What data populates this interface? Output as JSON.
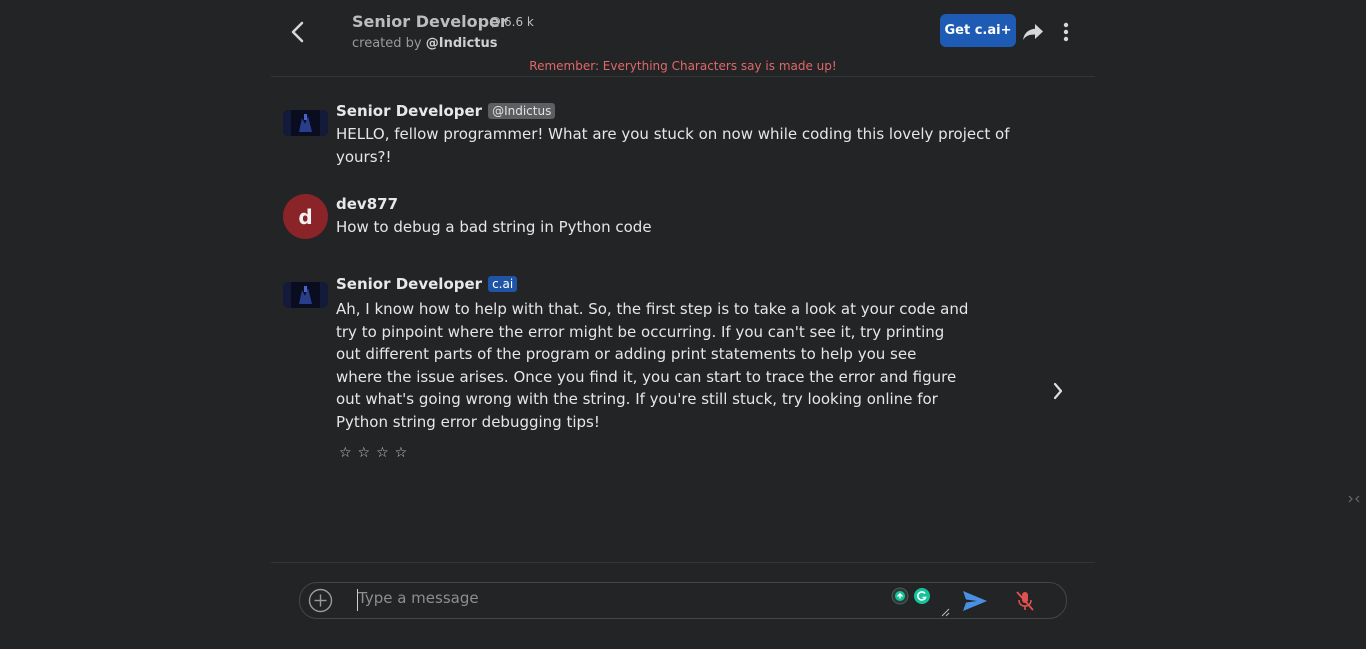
{
  "header": {
    "character_name": "Senior Developer",
    "chat_count": "6.6 k",
    "created_by_prefix": "created by",
    "creator_handle": "@Indictus",
    "upgrade_label": "Get c.ai+",
    "disclaimer": "Remember: Everything Characters say is made up!"
  },
  "messages": [
    {
      "author": "Senior Developer",
      "tag": "@Indictus",
      "lines": [
        "HELLO, fellow programmer! What are you stuck on now while coding this lovely project of",
        "yours?!"
      ]
    },
    {
      "author": "dev877",
      "avatar_letter": "d",
      "lines": [
        "How to debug a bad string in Python code"
      ]
    },
    {
      "author": "Senior Developer",
      "tag": "c.ai",
      "lines": [
        "Ah, I know how to help with that. So, the first step is to take a look at your code and",
        "try to pinpoint where the error might be occurring. If you can't see it, try printing",
        "out different parts of the program or adding print statements to help you see",
        "where the issue arises. Once you find it, you can start to trace the error and figure",
        "out what's going wrong with the string. If you're still stuck, try looking online for",
        "Python string error debugging tips!"
      ],
      "rating_stars": "☆☆☆☆",
      "rating_value": 0
    }
  ],
  "composer": {
    "placeholder": "Type a message"
  },
  "colors": {
    "background": "#232425",
    "accent": "#1e5bb4",
    "disclaimer": "#e0686a",
    "user_avatar": "#8b2428",
    "send": "#4a90e2",
    "mic_muted": "#e05050"
  },
  "icons": {
    "back": "chevron-left-icon",
    "chat_count": "chat-bubble-icon",
    "share": "share-arrow-icon",
    "more": "vertical-dots-icon",
    "next": "chevron-right-icon",
    "add": "plus-circle-icon",
    "send": "send-icon",
    "mic": "mic-off-icon"
  }
}
